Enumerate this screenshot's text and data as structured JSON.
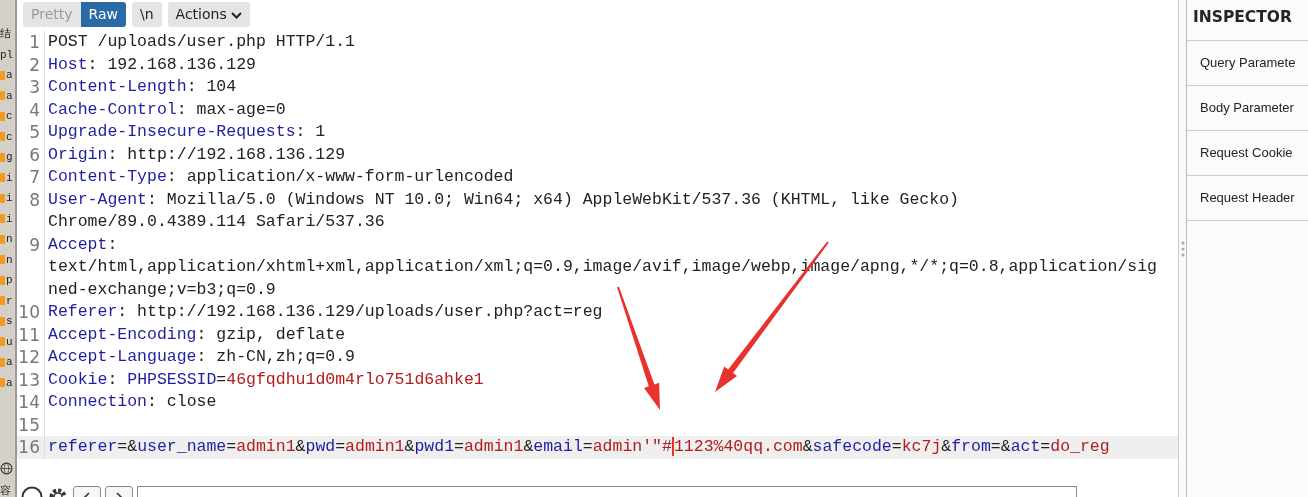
{
  "side_strip": {
    "top_texts": [
      "结",
      "pl"
    ],
    "files": [
      "a",
      "a",
      "c",
      "c",
      "g",
      "i",
      "i",
      "i",
      "n",
      "n",
      "p",
      "r",
      "s",
      "u",
      "a",
      "a"
    ],
    "bottom_text": "容"
  },
  "toolbar": {
    "view_tabs": [
      {
        "label": "Pretty",
        "selected": false
      },
      {
        "label": "Raw",
        "selected": true
      }
    ],
    "newline_button": "\\n",
    "actions_button": "Actions"
  },
  "editor": {
    "lines": [
      {
        "number": "1",
        "current": false,
        "rows": [
          [
            {
              "kind": "plain",
              "text": "POST /uploads/user.php HTTP/1.1"
            }
          ]
        ]
      },
      {
        "number": "2",
        "current": false,
        "rows": [
          [
            {
              "kind": "key",
              "text": "Host"
            },
            {
              "kind": "plain",
              "text": ": 192.168.136.129"
            }
          ]
        ]
      },
      {
        "number": "3",
        "current": false,
        "rows": [
          [
            {
              "kind": "key",
              "text": "Content-Length"
            },
            {
              "kind": "plain",
              "text": ": 104"
            }
          ]
        ]
      },
      {
        "number": "4",
        "current": false,
        "rows": [
          [
            {
              "kind": "key",
              "text": "Cache-Control"
            },
            {
              "kind": "plain",
              "text": ": max-age=0"
            }
          ]
        ]
      },
      {
        "number": "5",
        "current": false,
        "rows": [
          [
            {
              "kind": "key",
              "text": "Upgrade-Insecure-Requests"
            },
            {
              "kind": "plain",
              "text": ": 1"
            }
          ]
        ]
      },
      {
        "number": "6",
        "current": false,
        "rows": [
          [
            {
              "kind": "key",
              "text": "Origin"
            },
            {
              "kind": "plain",
              "text": ": http://192.168.136.129"
            }
          ]
        ]
      },
      {
        "number": "7",
        "current": false,
        "rows": [
          [
            {
              "kind": "key",
              "text": "Content-Type"
            },
            {
              "kind": "plain",
              "text": ": application/x-www-form-urlencoded"
            }
          ]
        ]
      },
      {
        "number": "8",
        "current": false,
        "rows": [
          [
            {
              "kind": "key",
              "text": "User-Agent"
            },
            {
              "kind": "plain",
              "text": ": Mozilla/5.0 (Windows NT 10.0; Win64; x64) AppleWebKit/537.36 (KHTML, like Gecko)"
            }
          ],
          [
            {
              "kind": "plain",
              "text": "Chrome/89.0.4389.114 Safari/537.36"
            }
          ]
        ]
      },
      {
        "number": "9",
        "current": false,
        "rows": [
          [
            {
              "kind": "key",
              "text": "Accept"
            },
            {
              "kind": "plain",
              "text": ":"
            }
          ],
          [
            {
              "kind": "plain",
              "text": "text/html,application/xhtml+xml,application/xml;q=0.9,image/avif,image/webp,image/apng,*/*;q=0.8,application/sig"
            }
          ],
          [
            {
              "kind": "plain",
              "text": "ned-exchange;v=b3;q=0.9"
            }
          ]
        ]
      },
      {
        "number": "10",
        "current": false,
        "rows": [
          [
            {
              "kind": "key",
              "text": "Referer"
            },
            {
              "kind": "plain",
              "text": ": http://192.168.136.129/uploads/user.php?act=reg"
            }
          ]
        ]
      },
      {
        "number": "11",
        "current": false,
        "rows": [
          [
            {
              "kind": "key",
              "text": "Accept-Encoding"
            },
            {
              "kind": "plain",
              "text": ": gzip, deflate"
            }
          ]
        ]
      },
      {
        "number": "12",
        "current": false,
        "rows": [
          [
            {
              "kind": "key",
              "text": "Accept-Language"
            },
            {
              "kind": "plain",
              "text": ": zh-CN,zh;q=0.9"
            }
          ]
        ]
      },
      {
        "number": "13",
        "current": false,
        "rows": [
          [
            {
              "kind": "key",
              "text": "Cookie"
            },
            {
              "kind": "plain",
              "text": ": "
            },
            {
              "kind": "name",
              "text": "PHPSESSID"
            },
            {
              "kind": "plain",
              "text": "="
            },
            {
              "kind": "value",
              "text": "46gfqdhu1d0m4rlo751d6ahke1"
            }
          ]
        ]
      },
      {
        "number": "14",
        "current": false,
        "rows": [
          [
            {
              "kind": "key",
              "text": "Connection"
            },
            {
              "kind": "plain",
              "text": ": close"
            }
          ]
        ]
      },
      {
        "number": "15",
        "current": false,
        "rows": [
          []
        ]
      },
      {
        "number": "16",
        "current": true,
        "rows": [
          [
            {
              "kind": "name",
              "text": "referer"
            },
            {
              "kind": "plain",
              "text": "=&"
            },
            {
              "kind": "name",
              "text": "user_name"
            },
            {
              "kind": "plain",
              "text": "="
            },
            {
              "kind": "value",
              "text": "admin1"
            },
            {
              "kind": "plain",
              "text": "&"
            },
            {
              "kind": "name",
              "text": "pwd"
            },
            {
              "kind": "plain",
              "text": "="
            },
            {
              "kind": "value",
              "text": "admin1"
            },
            {
              "kind": "plain",
              "text": "&"
            },
            {
              "kind": "name",
              "text": "pwd1"
            },
            {
              "kind": "plain",
              "text": "="
            },
            {
              "kind": "value",
              "text": "admin1"
            },
            {
              "kind": "plain",
              "text": "&"
            },
            {
              "kind": "name",
              "text": "email"
            },
            {
              "kind": "plain",
              "text": "="
            },
            {
              "kind": "value",
              "text": "admin'\"#",
              "caret_after": true
            },
            {
              "kind": "value",
              "text": "1123%40qq.com"
            },
            {
              "kind": "plain",
              "text": "&"
            },
            {
              "kind": "name",
              "text": "safecode"
            },
            {
              "kind": "plain",
              "text": "="
            },
            {
              "kind": "value",
              "text": "kc7j"
            },
            {
              "kind": "plain",
              "text": "&"
            },
            {
              "kind": "name",
              "text": "from"
            },
            {
              "kind": "plain",
              "text": "=&"
            },
            {
              "kind": "name",
              "text": "act"
            },
            {
              "kind": "plain",
              "text": "="
            },
            {
              "kind": "value",
              "text": "do_reg"
            }
          ]
        ]
      }
    ]
  },
  "annotations": [
    {
      "kind": "arrow"
    },
    {
      "kind": "arrow"
    }
  ],
  "inspector": {
    "title": "INSPECTOR",
    "sections": [
      "Query Paramete",
      "Body Parameter",
      "Request Cookie",
      "Request Header"
    ]
  }
}
